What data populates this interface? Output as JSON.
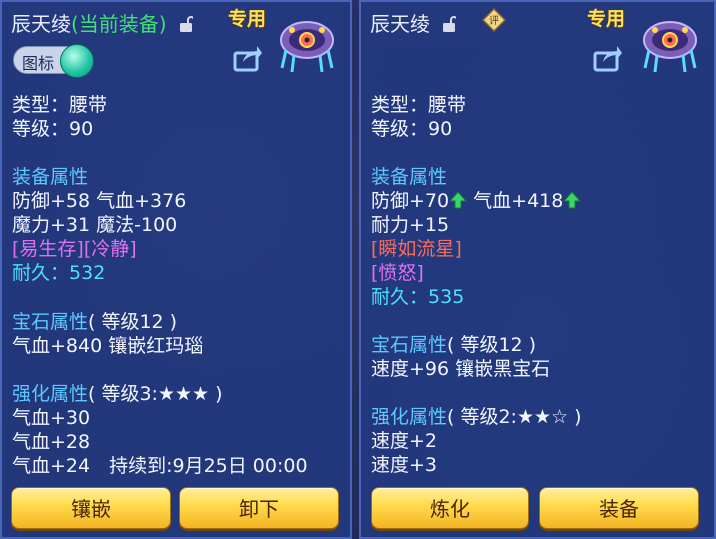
{
  "left": {
    "name": "辰天绫",
    "status": "(当前装备)",
    "special": "专用",
    "toggle_label": "图标",
    "type": "类型：腰带",
    "level": "等级：90",
    "equip_attr_header": "装备属性",
    "equip_line1": "防御+58 气血+376",
    "equip_line2": "魔力+31 魔法-100",
    "effect_line": "[易生存][冷静]",
    "durability_label": "耐久：",
    "durability_value": "532",
    "gem_header": "宝石属性",
    "gem_level": "( 等级12 )",
    "gem_line": "气血+840 镶嵌红玛瑙",
    "enhance_header": "强化属性",
    "enhance_level": "( 等级3:★★★ )",
    "enhance_line1": "气血+30",
    "enhance_line2": "气血+28",
    "enhance_line3": "气血+24　持续到:9月25日 00:00",
    "button1": "镶嵌",
    "button2": "卸下"
  },
  "right": {
    "name": "辰天绫",
    "rate_icon_text": "评",
    "special": "专用",
    "type": "类型：腰带",
    "level": "等级：90",
    "equip_attr_header": "装备属性",
    "equip_defense": "防御+70",
    "equip_hp": "气血+418",
    "equip_line2": "耐力+15",
    "effect_line1": "[瞬如流星]",
    "effect_line2": "[愤怒]",
    "durability_label": "耐久：",
    "durability_value": "535",
    "gem_header": "宝石属性",
    "gem_level": "( 等级12 )",
    "gem_line": "速度+96 镶嵌黑宝石",
    "enhance_header": "强化属性",
    "enhance_level": "( 等级2:★★☆ )",
    "enhance_line1": "速度+2",
    "enhance_line2": "速度+3",
    "button1": "炼化",
    "button2": "装备"
  }
}
